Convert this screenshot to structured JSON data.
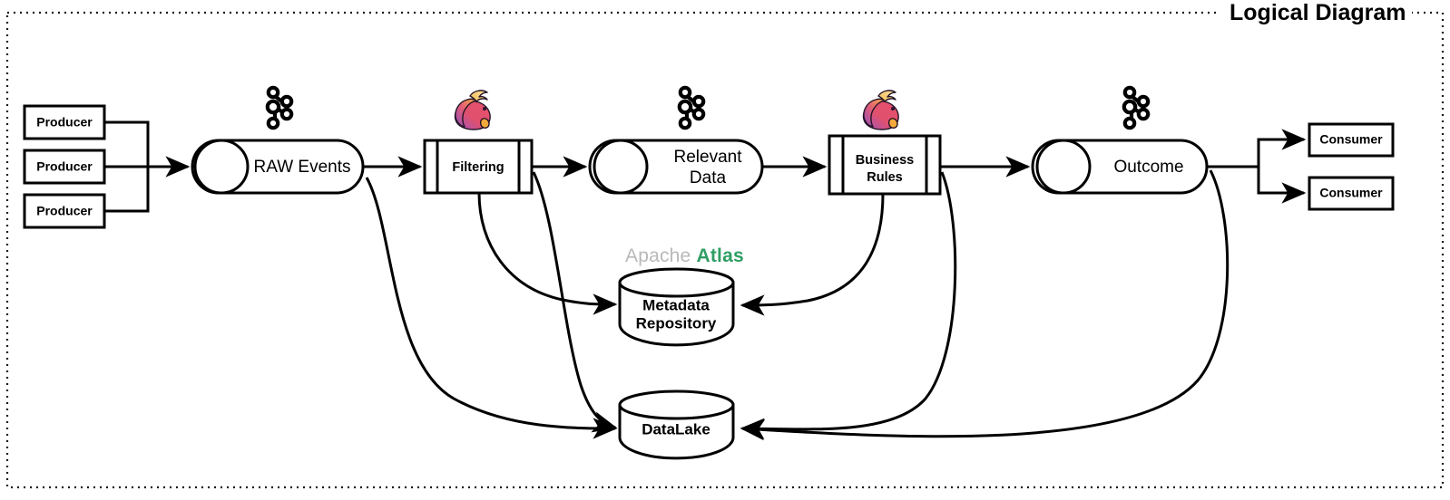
{
  "diagram": {
    "title": "Logical Diagram",
    "border_style": "dotted",
    "background": "#ffffff",
    "stroke_color": "#000000"
  },
  "branding": {
    "atlas_prefix": "Apache",
    "atlas_name": "Atlas",
    "atlas_prefix_color": "#b9b9b9",
    "atlas_name_color": "#2f9e63",
    "kafka_icon_color": "#000000",
    "flink_icon_colors": [
      "#e6526f",
      "#b05ac0",
      "#f5a623",
      "#f7d08a"
    ]
  },
  "producers": [
    {
      "label": "Producer"
    },
    {
      "label": "Producer"
    },
    {
      "label": "Producer"
    }
  ],
  "consumers": [
    {
      "label": "Consumer"
    },
    {
      "label": "Consumer"
    }
  ],
  "topics": [
    {
      "label": "RAW Events",
      "icon": "kafka-icon"
    },
    {
      "label": "Relevant Data",
      "line1": "Relevant",
      "line2": "Data",
      "icon": "kafka-icon"
    },
    {
      "label": "Outcome",
      "icon": "kafka-icon"
    }
  ],
  "processes": [
    {
      "label": "Filtering",
      "icon": "flink-icon"
    },
    {
      "label": "Business Rules",
      "line1": "Business",
      "line2": "Rules",
      "icon": "flink-icon"
    }
  ],
  "datastores": [
    {
      "label": "Metadata Repository",
      "line1": "Metadata",
      "line2": "Repository",
      "brand": "Apache Atlas"
    },
    {
      "label": "DataLake",
      "line1": "DataLake",
      "brand": ""
    }
  ],
  "flows": [
    {
      "from": "Producer",
      "to": "RAW Events"
    },
    {
      "from": "RAW Events",
      "to": "Filtering"
    },
    {
      "from": "Filtering",
      "to": "Relevant Data"
    },
    {
      "from": "Relevant Data",
      "to": "Business Rules"
    },
    {
      "from": "Business Rules",
      "to": "Outcome"
    },
    {
      "from": "Outcome",
      "to": "Consumer"
    },
    {
      "from": "RAW Events",
      "to": "DataLake"
    },
    {
      "from": "Filtering",
      "to": "Metadata Repository"
    },
    {
      "from": "Filtering",
      "to": "DataLake"
    },
    {
      "from": "Business Rules",
      "to": "Metadata Repository"
    },
    {
      "from": "Business Rules",
      "to": "DataLake"
    },
    {
      "from": "Outcome",
      "to": "DataLake"
    }
  ]
}
